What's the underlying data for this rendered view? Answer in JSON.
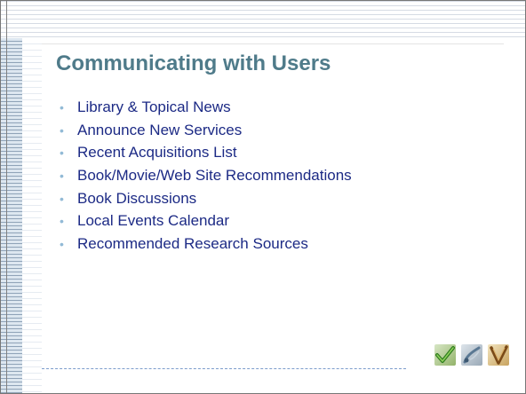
{
  "slide": {
    "title": "Communicating with Users",
    "bullets": [
      "Library & Topical News",
      "Announce New Services",
      "Recent Acquisitions List",
      "Book/Movie/Web Site Recommendations",
      "Book Discussions",
      "Local Events Calendar",
      "Recommended Research Sources"
    ]
  },
  "decorations": {
    "icons": [
      "check-mark-icon",
      "pen-nib-icon",
      "v-mark-icon"
    ]
  },
  "colors": {
    "title": "#4f7b8a",
    "bullet_text": "#1c2a85",
    "bullet_marker": "#92bad6",
    "stripes": "#8fa3b8"
  }
}
